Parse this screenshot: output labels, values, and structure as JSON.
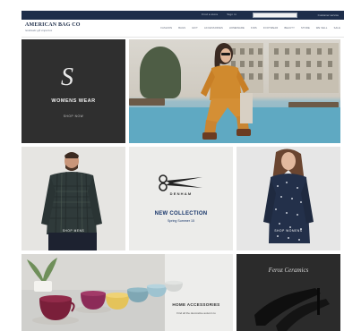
{
  "topbar": {
    "links": [
      "Find a store",
      "Sign in"
    ],
    "search_placeholder": "",
    "extra": "Customer service"
  },
  "brand": {
    "name": "AMERICAN BAG CO",
    "tagline": "handmade gift emporium"
  },
  "nav": [
    "FASHION",
    "BAGS",
    "GIFT",
    "ACCESSORIES",
    "HOMEWARE",
    "KIDS",
    "FOOTWEAR",
    "BEAUTY",
    "STORE",
    "WE SELL",
    "SALE"
  ],
  "tiles": {
    "womens": {
      "monogram": "S",
      "title": "WOMENS WEAR",
      "cta": "SHOP NOW"
    },
    "man": {
      "label": "SHOP MENS"
    },
    "denim": {
      "brand": "DENHAM",
      "collection": "NEW COLLECTION",
      "season": "Spring Summer 15"
    },
    "woman": {
      "label": "SHOP WOMENS"
    },
    "home": {
      "title": "HOME ACCESSORIES",
      "sub": "Find all the decorative autumn to"
    },
    "sign": {
      "script": "Feroz Ceramics"
    }
  },
  "colors": {
    "topbar": "#1e2e4a",
    "accent_blue": "#17356a",
    "dark_tile": "#2f2f2f"
  }
}
